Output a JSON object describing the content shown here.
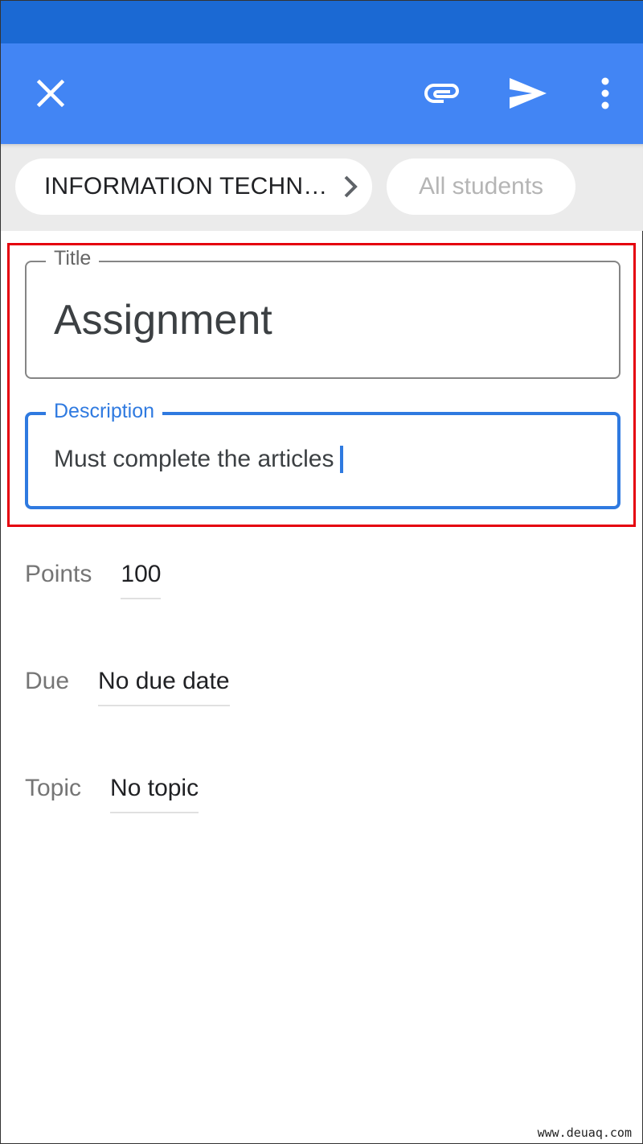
{
  "app_bar": {
    "close_icon": "close-icon",
    "attach_icon": "paperclip-icon",
    "send_icon": "send-icon",
    "more_icon": "more-vert-icon"
  },
  "chips": {
    "class_name": "INFORMATION TECHN…",
    "audience": "All students"
  },
  "form": {
    "title_label": "Title",
    "title_value": "Assignment",
    "description_label": "Description",
    "description_value": "Must complete the articles"
  },
  "details": {
    "points_label": "Points",
    "points_value": "100",
    "due_label": "Due",
    "due_value": "No due date",
    "topic_label": "Topic",
    "topic_value": "No topic"
  },
  "colors": {
    "status_bar": "#1b69d3",
    "app_bar": "#4285f4",
    "focus_accent": "#2f7ae0",
    "highlight": "#e5000d"
  },
  "watermark": "www.deuaq.com"
}
